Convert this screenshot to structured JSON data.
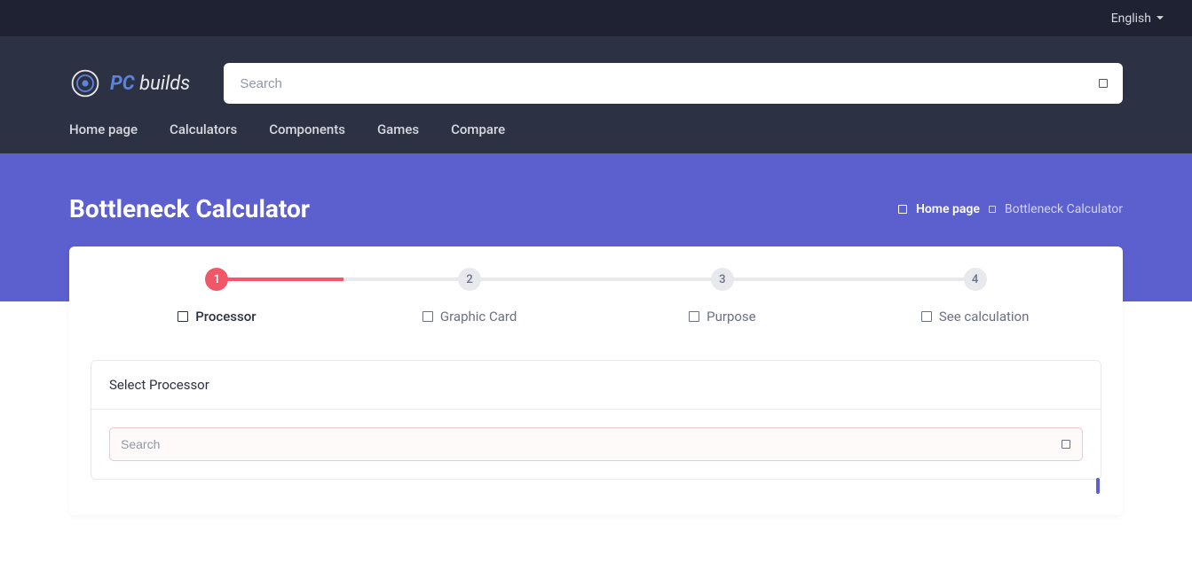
{
  "topbar": {
    "language": "English"
  },
  "logo": {
    "pc": "PC",
    "builds": " builds"
  },
  "search": {
    "placeholder": "Search"
  },
  "nav": {
    "items": [
      "Home page",
      "Calculators",
      "Components",
      "Games",
      "Compare"
    ]
  },
  "page": {
    "title": "Bottleneck Calculator"
  },
  "breadcrumb": {
    "home": "Home page",
    "current": "Bottleneck Calculator"
  },
  "stepper": {
    "steps": [
      {
        "num": "1",
        "label": "Processor"
      },
      {
        "num": "2",
        "label": "Graphic Card"
      },
      {
        "num": "3",
        "label": "Purpose"
      },
      {
        "num": "4",
        "label": "See calculation"
      }
    ]
  },
  "panel": {
    "title": "Select Processor",
    "search_placeholder": "Search"
  }
}
